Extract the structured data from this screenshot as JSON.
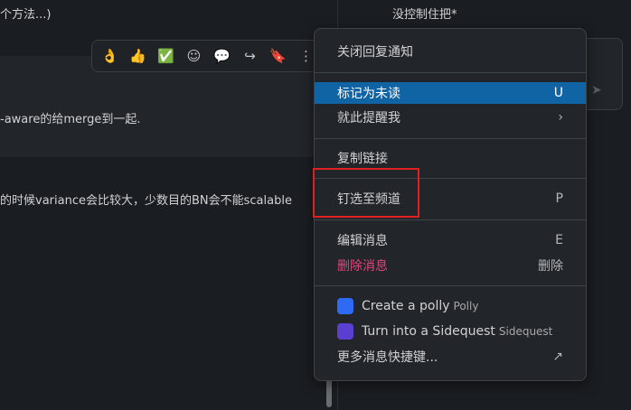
{
  "thread": {
    "line1": "个方法...)",
    "line2": "-aware的给merge到一起.",
    "line3": "的时候variance会比较大，少数目的BN会不能scalable"
  },
  "right_pane": {
    "text": "没控制住把*"
  },
  "toolbar": {
    "icons": [
      "ok-hand-icon",
      "thumbs-up-icon",
      "check-icon",
      "add-reaction-icon",
      "reply-in-thread-icon",
      "share-icon",
      "bookmark-icon",
      "more-actions-icon"
    ],
    "glyphs": [
      "👌",
      "👍",
      "✅",
      "☺",
      "💬",
      "↪",
      "🔖",
      "⋮"
    ]
  },
  "menu": {
    "item1": "关闭回复通知",
    "item2": {
      "label": "标记为未读",
      "shortcut": "U"
    },
    "item3": {
      "label": "就此提醒我",
      "chevron": "›"
    },
    "item4": "复制链接",
    "item5": {
      "label": "钉选至频道",
      "shortcut": "P"
    },
    "item6": {
      "label": "编辑消息",
      "shortcut": "E"
    },
    "item7": {
      "label": "删除消息",
      "shortcut": "删除"
    },
    "polly": {
      "label": "Create a polly",
      "app": "Polly",
      "color": "#2d6bf4"
    },
    "sidequest": {
      "label": "Turn into a Sidequest",
      "app": "Sidequest",
      "color": "#5b3fd1"
    },
    "more": {
      "label": "更多消息快捷键...",
      "icon": "↗"
    }
  },
  "colors": {
    "active_bg": "#1164a3",
    "danger": "#e0467a",
    "annotation": "#e02020"
  }
}
